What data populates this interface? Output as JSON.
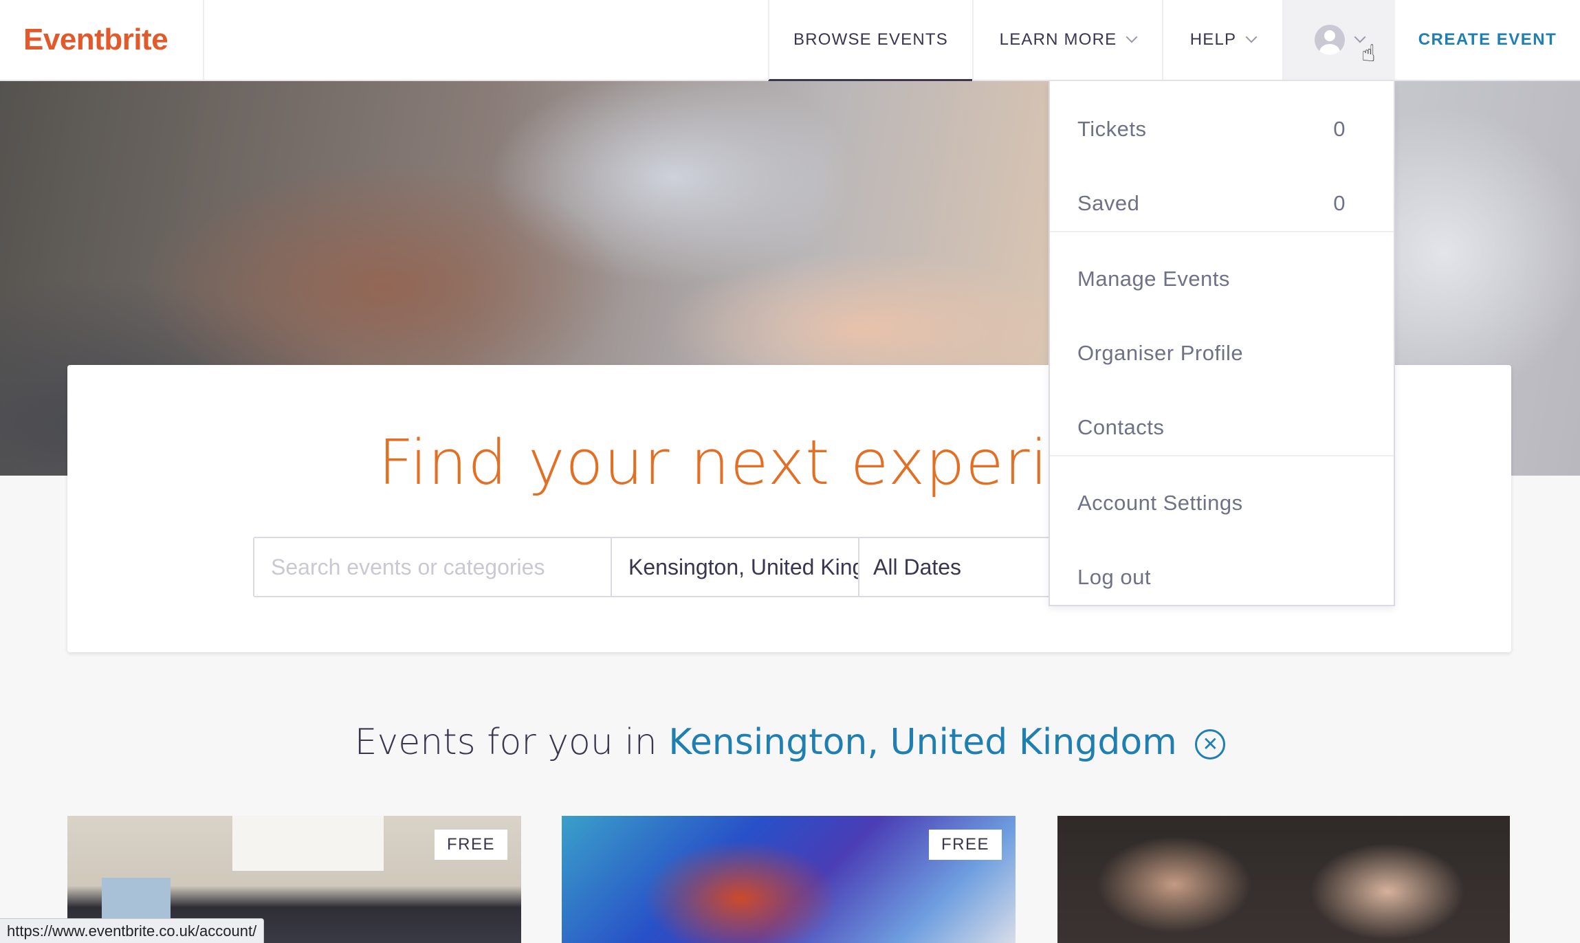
{
  "header": {
    "logo": "Eventbrite",
    "nav": {
      "browse": "BROWSE EVENTS",
      "learn_more": "LEARN MORE",
      "help": "HELP",
      "create": "CREATE EVENT"
    }
  },
  "user_menu": {
    "items": [
      {
        "label": "Tickets",
        "count": "0"
      },
      {
        "label": "Saved",
        "count": "0"
      },
      {
        "label": "Manage Events"
      },
      {
        "label": "Organiser Profile"
      },
      {
        "label": "Contacts"
      },
      {
        "label": "Account Settings"
      },
      {
        "label": "Log out"
      }
    ]
  },
  "hero": {
    "title": "Find your next experience",
    "search_placeholder": "Search events or categories",
    "location_value": "Kensington, United Kingdom",
    "date_value": "All Dates"
  },
  "events": {
    "heading_prefix": "Events for you in",
    "location": "Kensington, United Kingdom",
    "clear_glyph": "✕",
    "cards": [
      {
        "badge": "FREE"
      },
      {
        "badge": "FREE"
      },
      {
        "badge": ""
      }
    ]
  },
  "statusbar": {
    "url": "https://www.eventbrite.co.uk/account/"
  },
  "colors": {
    "brand": "#e25a2b",
    "title_orange": "#e36f24",
    "link_blue": "#1f7fb1"
  }
}
